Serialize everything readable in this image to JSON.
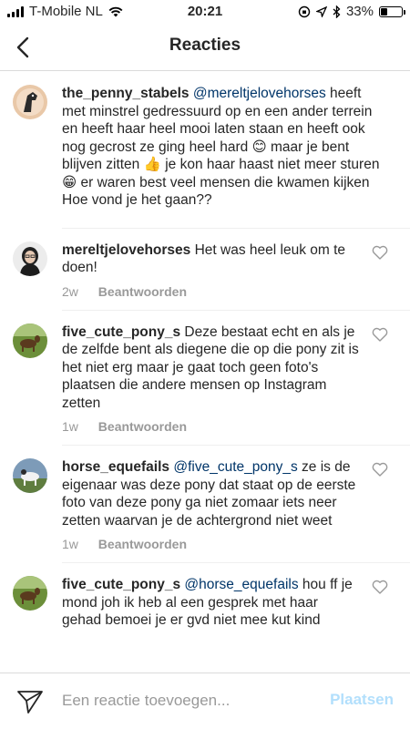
{
  "status": {
    "carrier": "T-Mobile NL",
    "time": "20:21",
    "battery": "33%",
    "battery_level": 0.33
  },
  "header": {
    "title": "Reacties"
  },
  "caption": {
    "username": "the_penny_stabels",
    "mention": "@mereltjelovehorses",
    "text1": " heeft met minstrel gedressuurd op en een ander terrein en heeft haar heel mooi laten staan en heeft ook nog gecrost ze ging heel hard ",
    "emoji1": "😊",
    "text2": " maar je bent blijven zitten ",
    "emoji2": "👍",
    "text3": " je kon haar haast niet meer sturen",
    "emoji3": "😁",
    "text4": " er waren best veel mensen die kwamen kijken",
    "text5": "Hoe vond je het gaan??"
  },
  "comments": [
    {
      "username": "mereltjelovehorses",
      "mention": "",
      "text": "Het was heel leuk om te doen!",
      "time": "2w",
      "reply": "Beantwoorden"
    },
    {
      "username": "five_cute_pony_s",
      "mention": "",
      "text": "Deze  bestaat echt en als je de zelfde bent als diegene die op die pony zit is het niet erg maar je gaat toch geen foto's plaatsen die andere mensen op Instagram zetten",
      "time": "1w",
      "reply": "Beantwoorden"
    },
    {
      "username": "horse_equefails",
      "mention": "@five_cute_pony_s",
      "text": " ze is de eigenaar was deze pony dat staat op de eerste foto van deze pony ga niet zomaar iets neer zetten waarvan je de achtergrond niet weet",
      "time": "1w",
      "reply": "Beantwoorden"
    },
    {
      "username": "five_cute_pony_s",
      "mention": "@horse_equefails",
      "text": " hou ff je mond joh ik heb al een gesprek met haar gehad bemoei je er gvd niet mee kut kind",
      "time": "",
      "reply": ""
    }
  ],
  "input": {
    "placeholder": "Een reactie toevoegen...",
    "post_label": "Plaatsen"
  }
}
